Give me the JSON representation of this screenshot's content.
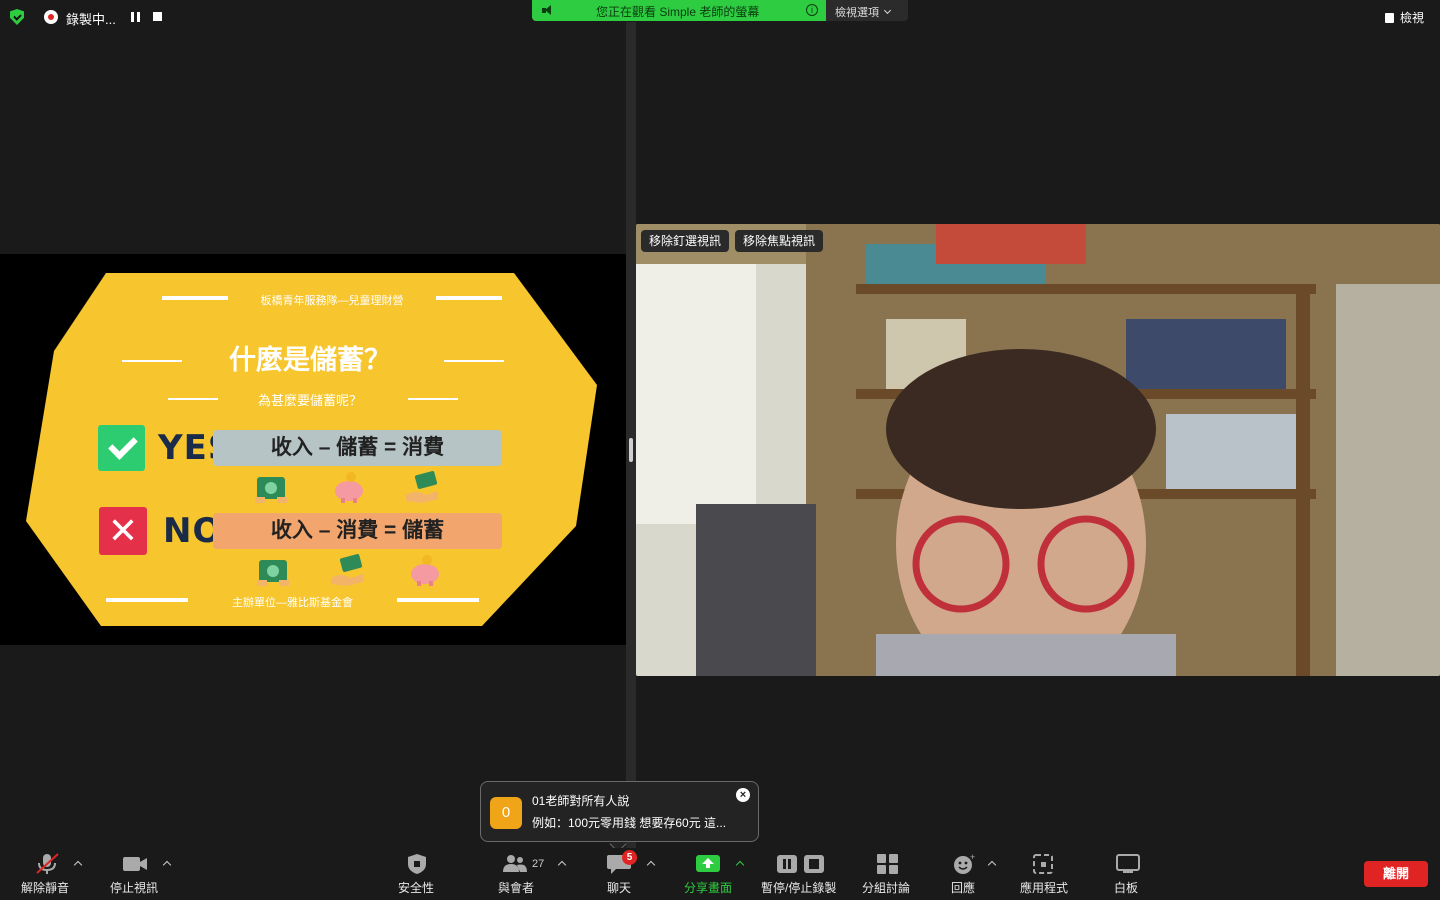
{
  "topbar": {
    "recording_label": "錄製中...",
    "banner_text": "您正在觀看 Simple 老師的螢幕",
    "view_options_label": "檢視選項",
    "view_button_label": "檢視"
  },
  "slide": {
    "org": "板橋青年服務隊—兒童理財營",
    "title": "什麼是儲蓄？",
    "subtitle": "為甚麼要儲蓄呢？",
    "yes_label": "YES",
    "no_label": "NO",
    "yes_formula": "收入 – 儲蓄 = 消費",
    "no_formula": "收入 – 消費 = 儲蓄",
    "host": "主辦單位—雅比斯基金會",
    "colors": {
      "background": "#f7c52d",
      "yes_box": "#2ecc71",
      "no_box": "#e5304a",
      "yes_formula_bg": "#b6c4c6",
      "no_formula_bg": "#f2a56c"
    },
    "yes_icons": [
      "money-bundle-icon",
      "piggy-bank-icon",
      "hand-money-icon"
    ],
    "no_icons": [
      "money-bundle-icon",
      "hand-money-icon",
      "piggy-bank-icon"
    ]
  },
  "video": {
    "remove_pin_label": "移除釘選視訊",
    "remove_spotlight_label": "移除焦點視訊"
  },
  "chat_toast": {
    "avatar_text": "0",
    "sender": "01老師對所有人說",
    "message": "例如：100元零用錢 想要存60元 這...",
    "close_icon": "close-icon"
  },
  "toolbar": {
    "unmute_label": "解除靜音",
    "stop_video_label": "停止視訊",
    "security_label": "安全性",
    "participants_label": "與會者",
    "participants_count": "27",
    "chat_label": "聊天",
    "chat_badge": "5",
    "share_label": "分享畫面",
    "pause_stop_record_label": "暫停/停止錄製",
    "breakout_label": "分組討論",
    "reactions_label": "回應",
    "apps_label": "應用程式",
    "whiteboard_label": "白板",
    "leave_label": "離開",
    "colors": {
      "share_green": "#2ecc40",
      "leave_red": "#e02424",
      "mute_red": "#e02424"
    }
  }
}
